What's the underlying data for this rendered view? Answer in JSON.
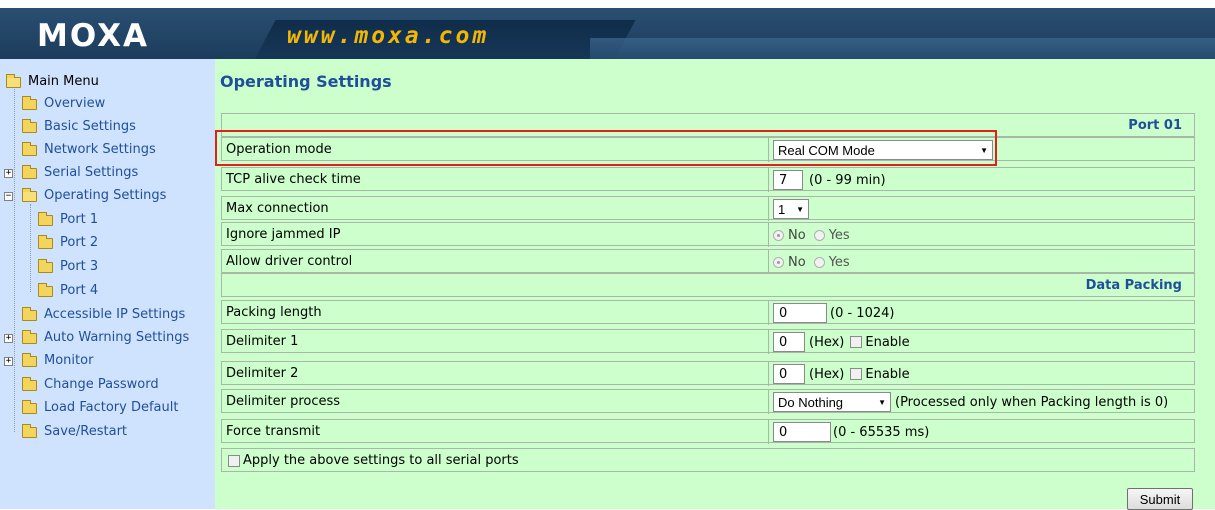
{
  "header": {
    "logo": "MOXA",
    "url": "www.moxa.com"
  },
  "sidebar": {
    "root": "Main Menu",
    "items": [
      {
        "label": "Overview"
      },
      {
        "label": "Basic Settings"
      },
      {
        "label": "Network Settings"
      },
      {
        "label": "Serial Settings"
      },
      {
        "label": "Operating Settings"
      },
      {
        "label": "Port 1"
      },
      {
        "label": "Port 2"
      },
      {
        "label": "Port 3"
      },
      {
        "label": "Port 4"
      },
      {
        "label": "Accessible IP Settings"
      },
      {
        "label": "Auto Warning Settings"
      },
      {
        "label": "Monitor"
      },
      {
        "label": "Change Password"
      },
      {
        "label": "Load Factory Default"
      },
      {
        "label": "Save/Restart"
      }
    ]
  },
  "main": {
    "title": "Operating Settings",
    "port_header": "Port 01",
    "data_packing_header": "Data Packing",
    "rows": {
      "operation_mode": {
        "label": "Operation mode",
        "value": "Real COM Mode"
      },
      "tcp_alive": {
        "label": "TCP alive check time",
        "value": "7",
        "hint": "(0 - 99 min)"
      },
      "max_connection": {
        "label": "Max connection",
        "value": "1"
      },
      "ignore_jammed": {
        "label": "Ignore jammed IP",
        "opt_no": "No",
        "opt_yes": "Yes",
        "selected": "No"
      },
      "allow_driver": {
        "label": "Allow driver control",
        "opt_no": "No",
        "opt_yes": "Yes",
        "selected": "No"
      },
      "packing_length": {
        "label": "Packing length",
        "value": "0",
        "hint": "(0 - 1024)"
      },
      "delimiter1": {
        "label": "Delimiter 1",
        "value": "0",
        "hint": "(Hex)",
        "enable": "Enable"
      },
      "delimiter2": {
        "label": "Delimiter 2",
        "value": "0",
        "hint": "(Hex)",
        "enable": "Enable"
      },
      "delimiter_process": {
        "label": "Delimiter process",
        "value": "Do Nothing",
        "hint": "(Processed only when Packing length is 0)"
      },
      "force_transmit": {
        "label": "Force transmit",
        "value": "0",
        "hint": "(0 - 65535 ms)"
      }
    },
    "apply_all": "Apply the above settings to all serial ports",
    "submit": "Submit"
  }
}
